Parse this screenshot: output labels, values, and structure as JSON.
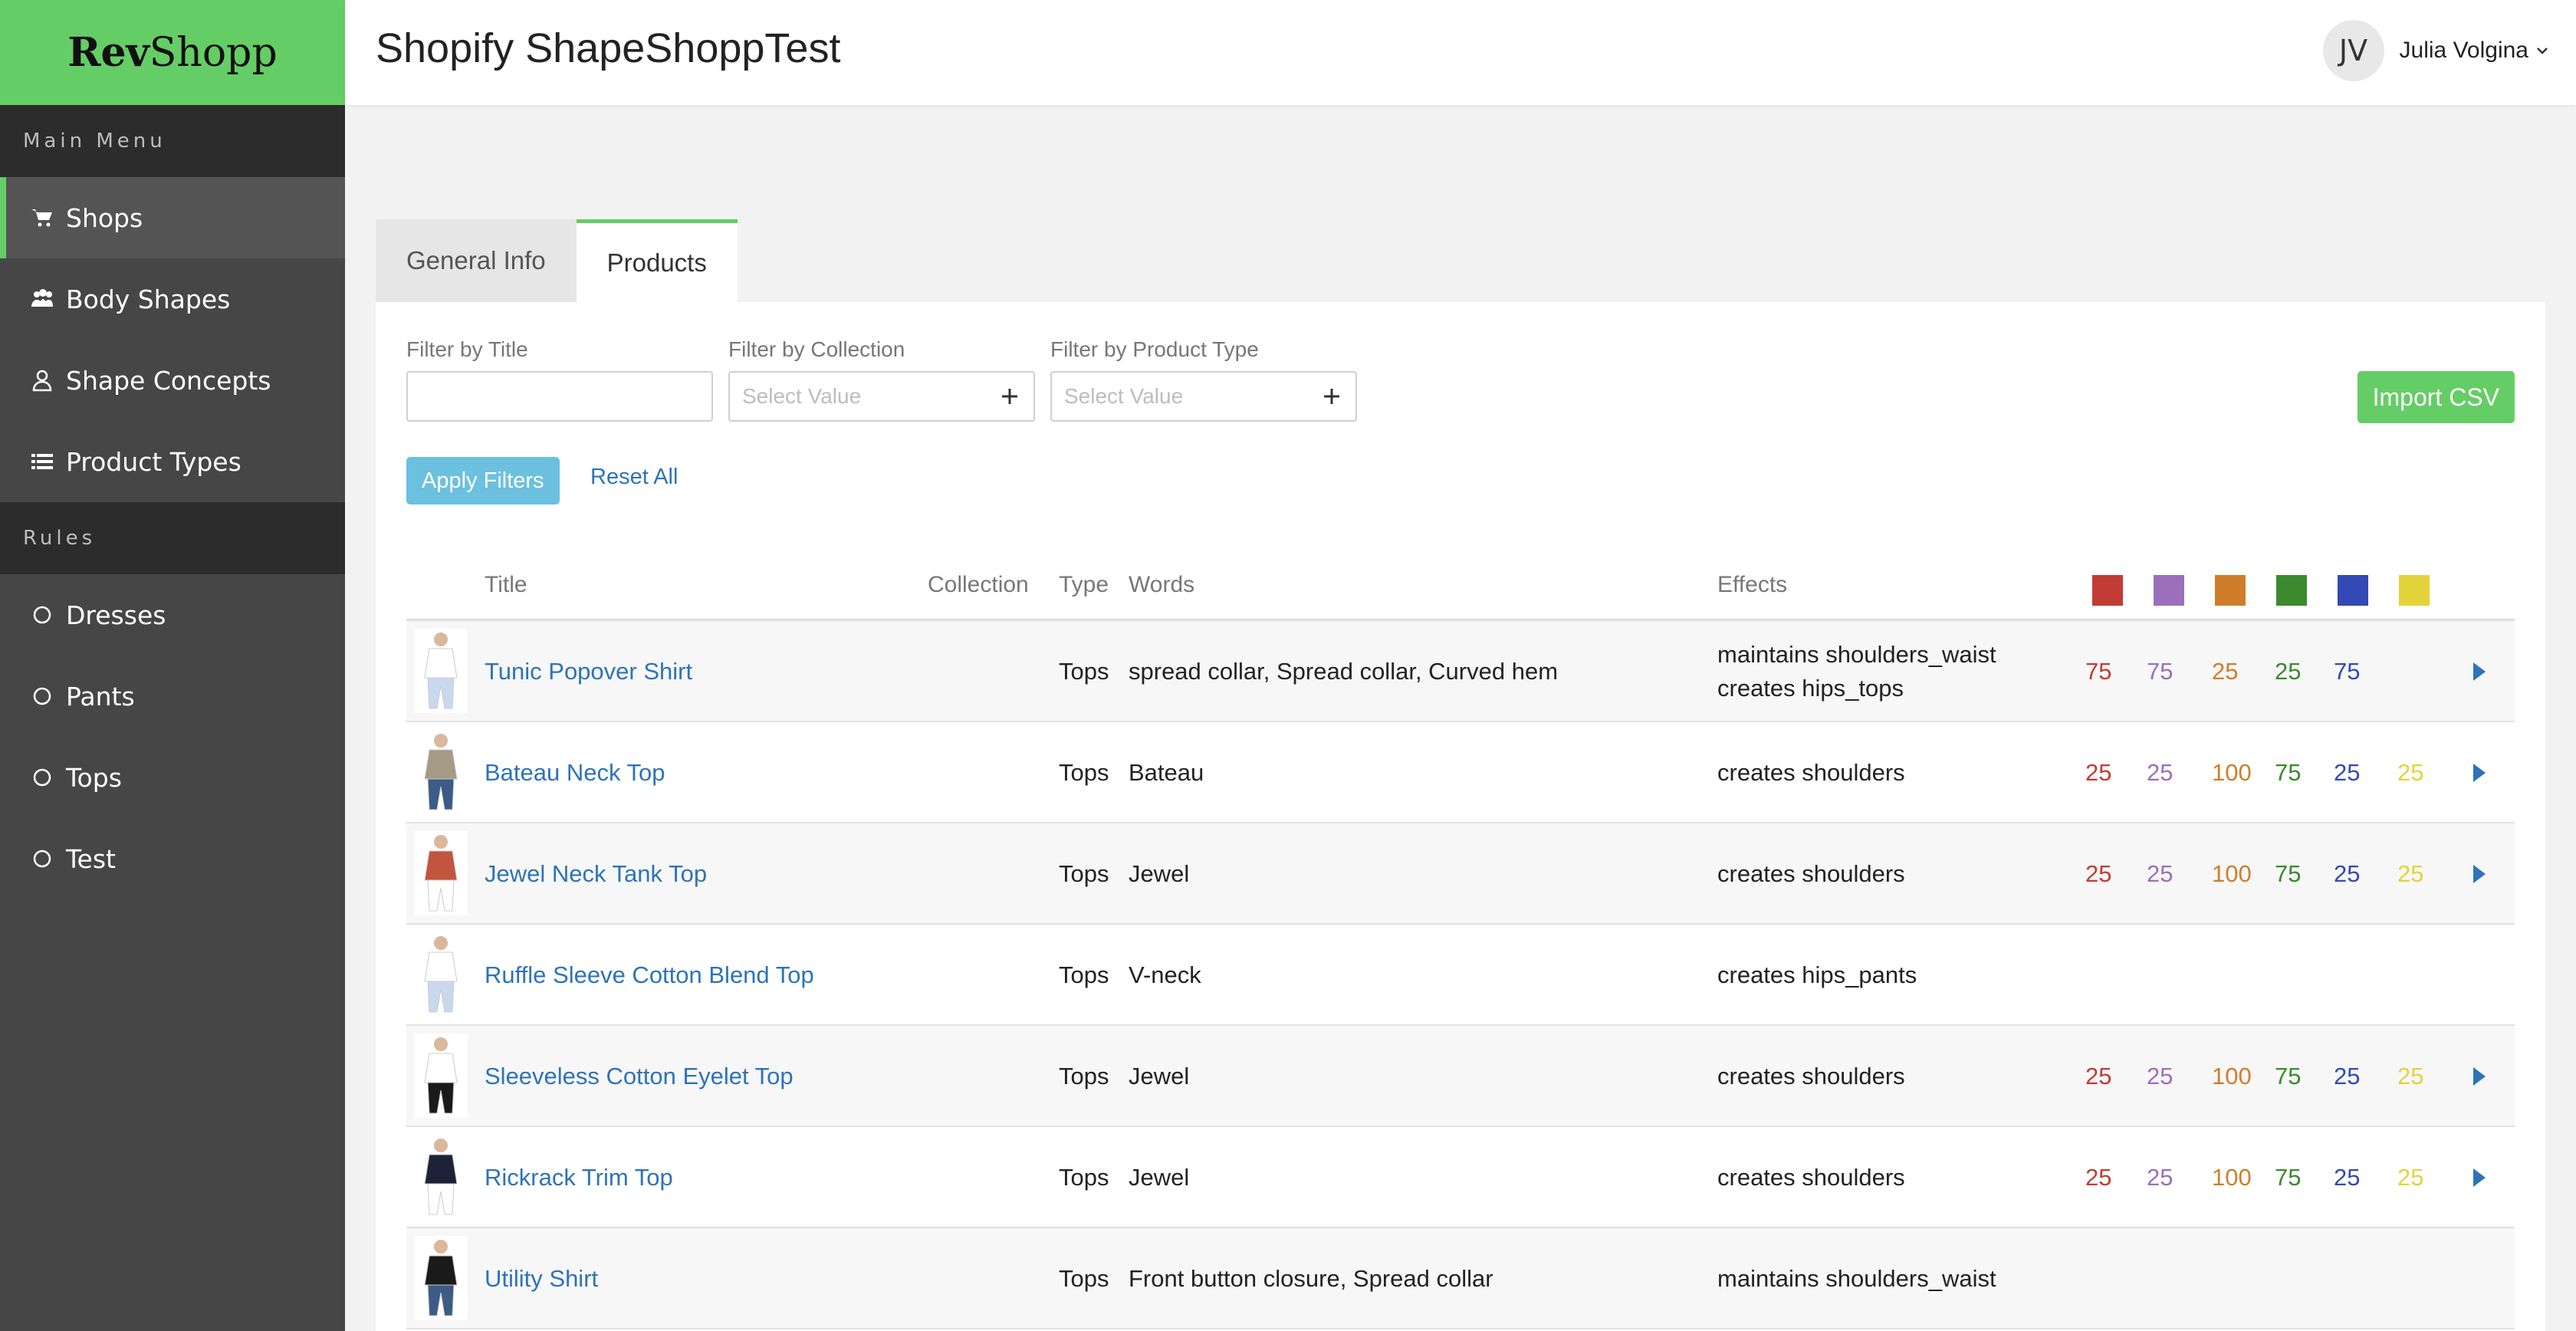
{
  "app": {
    "logo_bold": "Rev",
    "logo_rest": "Shopp",
    "page_title": "Shopify ShapeShoppTest"
  },
  "user": {
    "initials": "JV",
    "name": "Julia Volgina"
  },
  "sidebar": {
    "main_header": "Main Menu",
    "main_items": [
      {
        "label": "Shops",
        "icon": "cart-icon",
        "active": true
      },
      {
        "label": "Body Shapes",
        "icon": "users-icon"
      },
      {
        "label": "Shape Concepts",
        "icon": "user-outline-icon"
      },
      {
        "label": "Product Types",
        "icon": "list-icon"
      }
    ],
    "rules_header": "Rules",
    "rule_items": [
      {
        "label": "Dresses",
        "icon": "circle-icon"
      },
      {
        "label": "Pants",
        "icon": "circle-icon"
      },
      {
        "label": "Tops",
        "icon": "circle-icon"
      },
      {
        "label": "Test",
        "icon": "circle-icon"
      }
    ]
  },
  "tabs": [
    {
      "label": "General Info",
      "active": false
    },
    {
      "label": "Products",
      "active": true
    }
  ],
  "filters": {
    "title_label": "Filter by Title",
    "title_value": "",
    "collection_label": "Filter by Collection",
    "collection_placeholder": "Select Value",
    "type_label": "Filter by Product Type",
    "type_placeholder": "Select Value",
    "apply_label": "Apply Filters",
    "reset_label": "Reset All",
    "import_label": "Import CSV"
  },
  "colors": {
    "accent": "#65cd66",
    "link": "#2e73ba",
    "swatches": [
      "#c23b34",
      "#9b6fbb",
      "#d07d2b",
      "#3b8a2d",
      "#3349b5",
      "#e3d33a"
    ]
  },
  "table": {
    "headers": {
      "title": "Title",
      "collection": "Collection",
      "type": "Type",
      "words": "Words",
      "effects": "Effects"
    },
    "rows": [
      {
        "title": "Tunic Popover Shirt",
        "collection": "",
        "type": "Tops",
        "words": "spread collar, Spread collar, Curved hem",
        "effects": [
          "maintains shoulders_waist",
          "creates hips_tops"
        ],
        "scores": [
          "75",
          "75",
          "25",
          "25",
          "75",
          ""
        ],
        "has_arrow": true
      },
      {
        "title": "Bateau Neck Top",
        "collection": "",
        "type": "Tops",
        "words": "Bateau",
        "effects": [
          "creates shoulders"
        ],
        "scores": [
          "25",
          "25",
          "100",
          "75",
          "25",
          "25"
        ],
        "has_arrow": true
      },
      {
        "title": "Jewel Neck Tank Top",
        "collection": "",
        "type": "Tops",
        "words": "Jewel",
        "effects": [
          "creates shoulders"
        ],
        "scores": [
          "25",
          "25",
          "100",
          "75",
          "25",
          "25"
        ],
        "has_arrow": true
      },
      {
        "title": "Ruffle Sleeve Cotton Blend Top",
        "collection": "",
        "type": "Tops",
        "words": "V-neck",
        "effects": [
          "creates hips_pants"
        ],
        "scores": [
          "",
          "",
          "",
          "",
          "",
          ""
        ],
        "has_arrow": false
      },
      {
        "title": "Sleeveless Cotton Eyelet Top",
        "collection": "",
        "type": "Tops",
        "words": "Jewel",
        "effects": [
          "creates shoulders"
        ],
        "scores": [
          "25",
          "25",
          "100",
          "75",
          "25",
          "25"
        ],
        "has_arrow": true
      },
      {
        "title": "Rickrack Trim Top",
        "collection": "",
        "type": "Tops",
        "words": "Jewel",
        "effects": [
          "creates shoulders"
        ],
        "scores": [
          "25",
          "25",
          "100",
          "75",
          "25",
          "25"
        ],
        "has_arrow": true
      },
      {
        "title": "Utility Shirt",
        "collection": "",
        "type": "Tops",
        "words": "Front button closure, Spread collar",
        "effects": [
          "maintains shoulders_waist"
        ],
        "scores": [
          "",
          "",
          "",
          "",
          "",
          ""
        ],
        "has_arrow": false
      }
    ]
  }
}
